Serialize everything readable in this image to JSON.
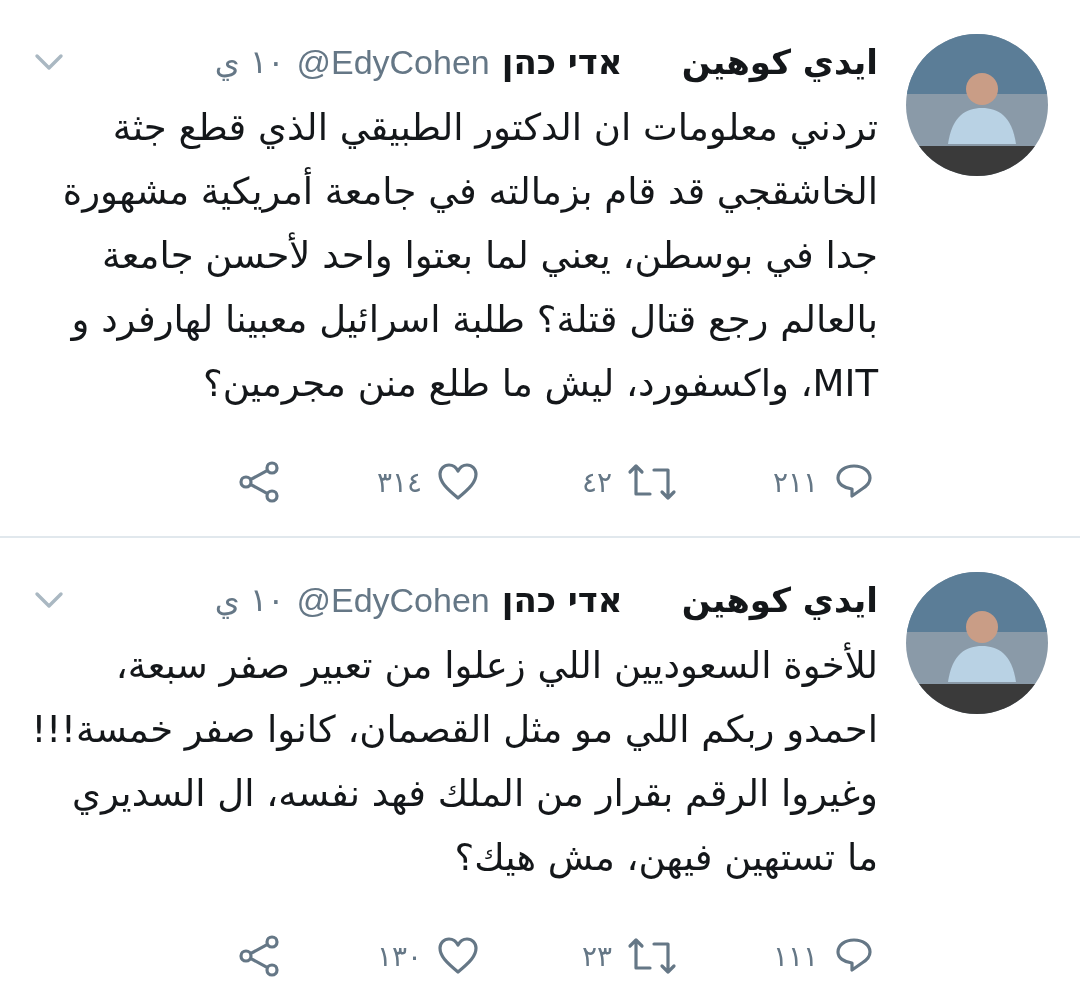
{
  "tweets": [
    {
      "name": "ايدي كوهين     אדי כהן",
      "handle": "@EdyCohen",
      "time": "١٠ ي",
      "text": "تردني معلومات ان الدكتور الطبيقي الذي قطع جثة الخاشقجي قد قام بزمالته في جامعة أمريكية مشهورة جدا في بوسطن، يعني لما بعتوا واحد لأحسن جامعة بالعالم رجع قتال قتلة؟ طلبة اسرائيل معبينا لهارفرد و MIT، واكسفورد، ليش ما طلع منن مجرمين؟",
      "replies": "٢١١",
      "retweets": "٤٢",
      "likes": "٣١٤"
    },
    {
      "name": "ايدي كوهين     אדי כהן",
      "handle": "@EdyCohen",
      "time": "١٠ ي",
      "text": "للأخوة السعوديين اللي زعلوا من تعبير صفر سبعة، احمدو ربكم اللي مو مثل القصمان، كانوا صفر خمسة!!! وغيروا الرقم بقرار من الملك فهد نفسه، ال السديري ما تستهين فيهن، مش هيك؟",
      "replies": "١١١",
      "retweets": "٢٣",
      "likes": "١٣٠"
    }
  ]
}
